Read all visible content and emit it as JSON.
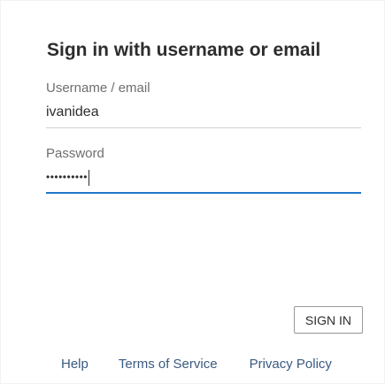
{
  "form": {
    "title": "Sign in with username or email",
    "username_label": "Username / email",
    "username_value": "ivanidea",
    "password_label": "Password",
    "password_masked": "••••••••••"
  },
  "actions": {
    "signin_label": "SIGN IN"
  },
  "footer": {
    "links": [
      "Help",
      "Terms of Service",
      "Privacy Policy"
    ]
  },
  "colors": {
    "focus_underline": "#1e78c8",
    "link": "#3a5a80",
    "text": "#2d2d2d",
    "muted": "#6e6e6e"
  }
}
